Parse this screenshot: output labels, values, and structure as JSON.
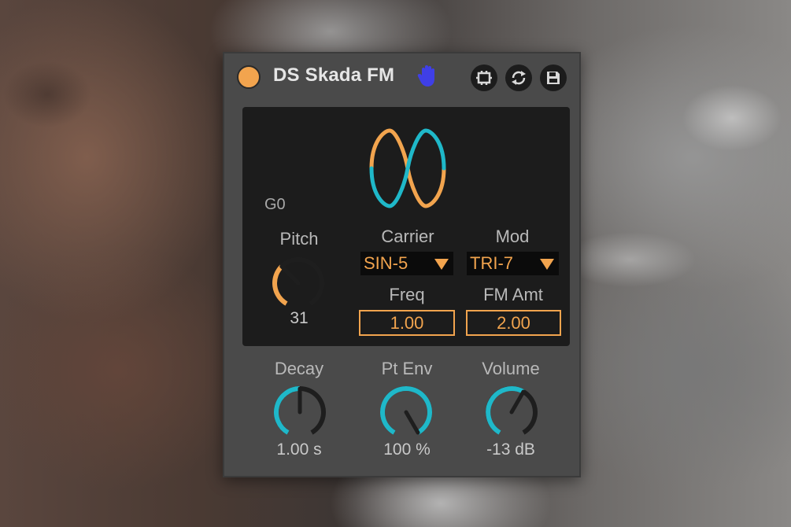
{
  "device": {
    "title": "DS Skada FM",
    "colors": {
      "accent_orange": "#f2a44e",
      "accent_cyan": "#1fb8c9",
      "panel": "#1c1c1c",
      "body": "#4a4a4a"
    },
    "icons": {
      "power": "power-toggle-icon",
      "hand": "hand-icon",
      "tb1": "midi-map-icon",
      "tb2": "hot-swap-icon",
      "tb3": "save-preset-icon"
    }
  },
  "display": {
    "note": "G0",
    "pitch": {
      "label": "Pitch",
      "value": "31",
      "fraction": 0.35
    },
    "carrier": {
      "label": "Carrier",
      "selected": "SIN-5"
    },
    "mod": {
      "label": "Mod",
      "selected": "TRI-7"
    },
    "freq": {
      "label": "Freq",
      "value": "1.00"
    },
    "fm_amt": {
      "label": "FM Amt",
      "value": "2.00"
    }
  },
  "bottom": {
    "decay": {
      "label": "Decay",
      "value": "1.00 s",
      "fraction": 0.5
    },
    "pt_env": {
      "label": "Pt Env",
      "value": "100 %",
      "fraction": 1.0
    },
    "volume": {
      "label": "Volume",
      "value": "-13 dB",
      "fraction": 0.6
    }
  }
}
